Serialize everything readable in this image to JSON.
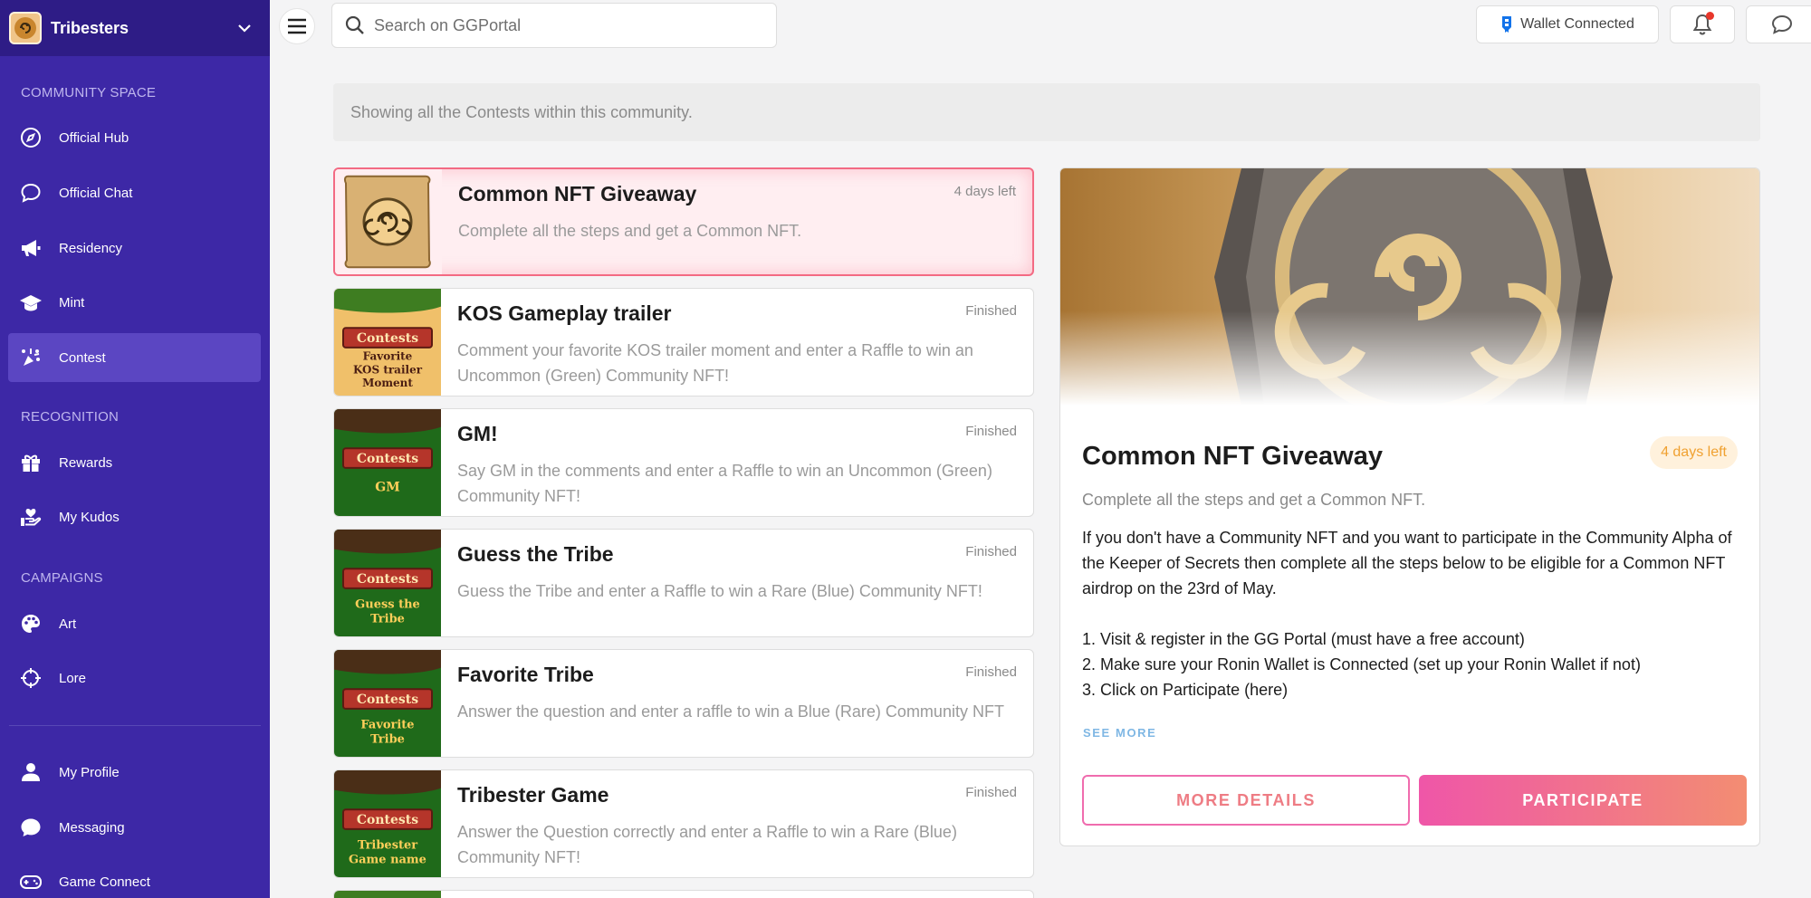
{
  "sidebar": {
    "title": "Tribesters",
    "sections": {
      "community": "COMMUNITY SPACE",
      "recognition": "RECOGNITION",
      "campaigns": "CAMPAIGNS"
    },
    "items": [
      {
        "label": "Official Hub",
        "icon": "compass-icon"
      },
      {
        "label": "Official Chat",
        "icon": "chat-bubble-icon"
      },
      {
        "label": "Residency",
        "icon": "megaphone-icon"
      },
      {
        "label": "Mint",
        "icon": "graduation-cap-icon"
      },
      {
        "label": "Contest",
        "icon": "confetti-icon",
        "active": true
      },
      {
        "label": "Rewards",
        "icon": "gift-icon"
      },
      {
        "label": "My Kudos",
        "icon": "hand-heart-icon"
      },
      {
        "label": "Art",
        "icon": "palette-icon"
      },
      {
        "label": "Lore",
        "icon": "crosshair-icon"
      },
      {
        "label": "My Profile",
        "icon": "person-icon"
      },
      {
        "label": "Messaging",
        "icon": "message-icon"
      },
      {
        "label": "Game Connect",
        "icon": "gamepad-icon"
      }
    ]
  },
  "topbar": {
    "search_placeholder": "Search on GGPortal",
    "wallet_label": "Wallet Connected"
  },
  "info": "Showing all the Contests within this community.",
  "contests": [
    {
      "title": "Common NFT Giveaway",
      "status": "4 days left",
      "desc": "Complete all the steps and get a Common NFT."
    },
    {
      "title": "KOS Gameplay trailer",
      "status": "Finished",
      "desc": "Comment your favorite KOS trailer moment and enter a Raffle to win an Uncommon (Green) Community NFT!",
      "thumb": [
        "Contests",
        "Favorite",
        "KOS trailer",
        "Moment"
      ]
    },
    {
      "title": "GM!",
      "status": "Finished",
      "desc": "Say GM in the comments and enter a Raffle to win an Uncommon (Green) Community NFT!",
      "thumb": [
        "Contests",
        "GM"
      ]
    },
    {
      "title": "Guess the Tribe",
      "status": "Finished",
      "desc": "Guess the Tribe and enter a Raffle to win a Rare (Blue) Community NFT!",
      "thumb": [
        "Contests",
        "Guess the",
        "Tribe"
      ]
    },
    {
      "title": "Favorite Tribe",
      "status": "Finished",
      "desc": "Answer the question and enter a raffle to win a Blue (Rare) Community NFT",
      "thumb": [
        "Contests",
        "Favorite",
        "Tribe"
      ]
    },
    {
      "title": "Tribester Game",
      "status": "Finished",
      "desc": "Answer the Question correctly and enter a Raffle to win a Rare (Blue) Community NFT!",
      "thumb": [
        "Contests",
        "Tribester",
        "Game name"
      ]
    }
  ],
  "detail": {
    "title": "Common NFT Giveaway",
    "badge": "4 days left",
    "subtitle": "Complete all the steps and get a Common NFT.",
    "body": "If you don't have a Community NFT and you want to participate in the Community Alpha of the Keeper of Secrets then complete all the steps below to be eligible for a Common NFT airdrop on the 23rd of May.",
    "steps": [
      "1. Visit & register in the GG Portal (must have a free account)",
      "2. Make sure your Ronin Wallet is Connected (set up your Ronin Wallet if not)",
      "3. Click on Participate (here)"
    ],
    "see_more": "SEE MORE",
    "more_details": "MORE DETAILS",
    "participate": "PARTICIPATE"
  }
}
